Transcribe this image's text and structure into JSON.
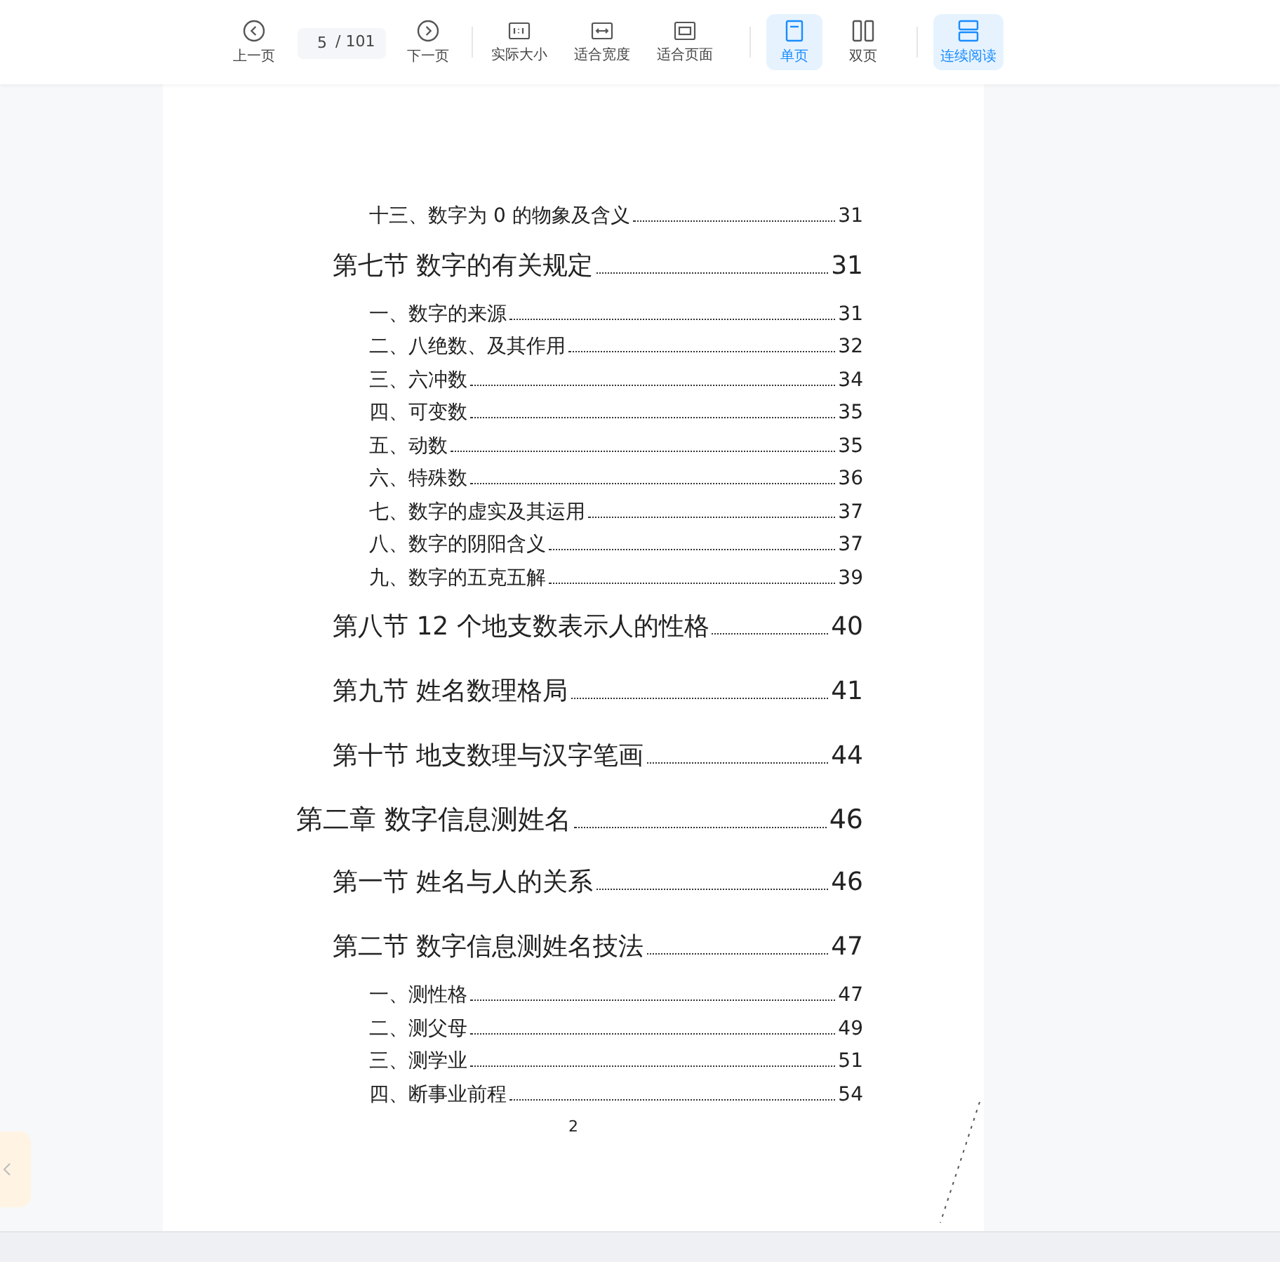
{
  "toolbar": {
    "prev": {
      "label": "上一页"
    },
    "page_input": {
      "value": "5"
    },
    "page_total": "/ 101",
    "next": {
      "label": "下一页"
    },
    "zoom": [
      {
        "kind": "actual",
        "label": "实际大小"
      },
      {
        "kind": "fit-width",
        "label": "适合宽度"
      },
      {
        "kind": "fit-page",
        "label": "适合页面"
      }
    ],
    "view": [
      {
        "kind": "single",
        "label": "单页",
        "selected": true
      },
      {
        "kind": "double",
        "label": "双页",
        "selected": false
      }
    ],
    "continuous": {
      "label": "连续阅读",
      "on": true
    }
  },
  "toc": [
    {
      "kind": "item",
      "title": "十三、数字为 0 的物象及含义",
      "page": "31"
    },
    {
      "kind": "section",
      "title": "第七节  数字的有关规定",
      "page": "31"
    },
    {
      "kind": "item",
      "title": "一、数字的来源",
      "page": "31"
    },
    {
      "kind": "item",
      "title": "二、八绝数、及其作用",
      "page": "32"
    },
    {
      "kind": "item",
      "title": "三、六冲数",
      "page": "34"
    },
    {
      "kind": "item",
      "title": "四、可变数",
      "page": "35"
    },
    {
      "kind": "item",
      "title": "五、动数",
      "page": "35"
    },
    {
      "kind": "item",
      "title": "六、特殊数",
      "page": "36"
    },
    {
      "kind": "item",
      "title": "七、数字的虚实及其运用",
      "page": "37"
    },
    {
      "kind": "item",
      "title": "八、数字的阴阳含义",
      "page": "37"
    },
    {
      "kind": "item",
      "title": "九、数字的五克五解",
      "page": "39"
    },
    {
      "kind": "section",
      "title": "第八节  12 个地支数表示人的性格",
      "page": "40"
    },
    {
      "kind": "section",
      "title": "第九节  姓名数理格局",
      "page": "41"
    },
    {
      "kind": "section",
      "title": "第十节  地支数理与汉字笔画",
      "page": "44"
    },
    {
      "kind": "chapter",
      "title": "第二章  数字信息测姓名",
      "page": "46"
    },
    {
      "kind": "section",
      "title": "第一节  姓名与人的关系",
      "page": "46"
    },
    {
      "kind": "section",
      "title": "第二节  数字信息测姓名技法",
      "page": "47"
    },
    {
      "kind": "item",
      "title": "一、测性格",
      "page": "47"
    },
    {
      "kind": "item",
      "title": "二、测父母",
      "page": "49"
    },
    {
      "kind": "item",
      "title": "三、测学业",
      "page": "51"
    },
    {
      "kind": "item",
      "title": "四、断事业前程",
      "page": "54"
    }
  ],
  "page_number": "2"
}
